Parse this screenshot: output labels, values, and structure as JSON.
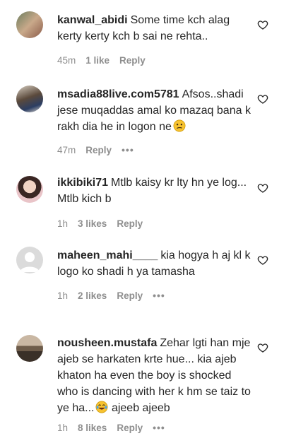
{
  "comments": [
    {
      "username": "kanwal_abidi",
      "text": "Some time kch alag kerty kerty kch b sai ne rehta..",
      "time": "45m",
      "likes": "1 like",
      "reply": "Reply",
      "more": ""
    },
    {
      "username": "msadia88live.com5781",
      "text": "Afsos..shadi jese muqaddas amal ko mazaq bana k rakh dia he in logon ne",
      "emoji": "confused-face",
      "time": "47m",
      "likes": "",
      "reply": "Reply",
      "more": "•••"
    },
    {
      "username": "ikkibiki71",
      "text": "Mtlb kaisy kr lty hn ye log... Mtlb kich b",
      "time": "1h",
      "likes": "3 likes",
      "reply": "Reply",
      "more": ""
    },
    {
      "username": "maheen_mahi____",
      "text": "kia hogya h aj kl k logo ko shadi h ya tamasha",
      "time": "1h",
      "likes": "2 likes",
      "reply": "Reply",
      "more": "•••"
    },
    {
      "username": "nousheen.mustafa",
      "text": "Zehar lgti han mje ajeb se harkaten krte hue... kia ajeb khaton ha even the boy is shocked who is dancing with her k hm se taiz to ye ha...",
      "text_after": "ajeeb ajeeb",
      "emoji": "tears-of-joy-face",
      "time": "1h",
      "likes": "8 likes",
      "reply": "Reply",
      "more": "•••"
    }
  ]
}
